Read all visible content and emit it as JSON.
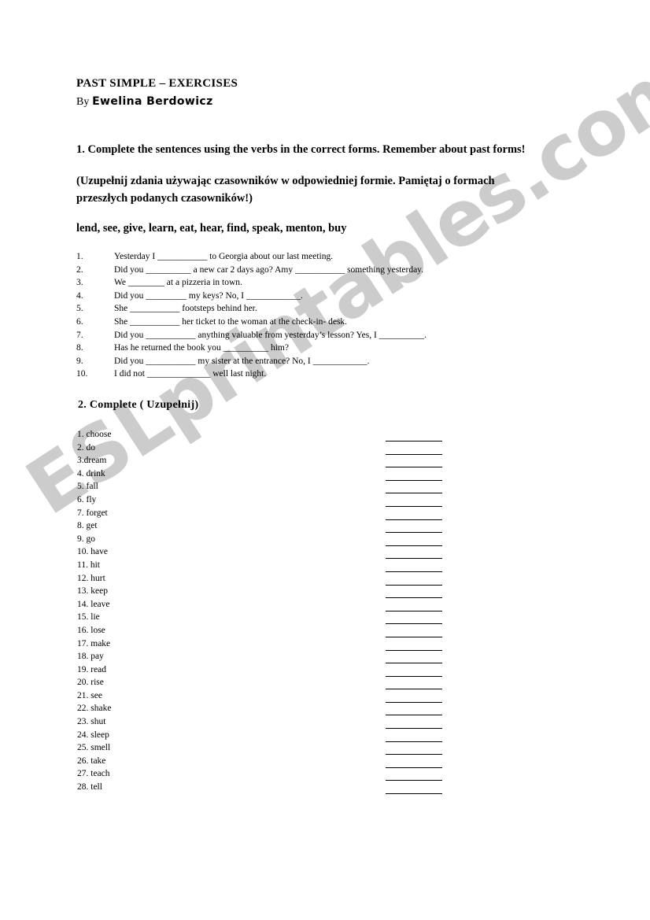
{
  "document": {
    "title": "PAST SIMPLE – EXERCISES",
    "byline_prefix": "By",
    "author": "Ewelina  Berdowicz",
    "watermark": "ESLprintables.com",
    "watermark_color": "#cccccc",
    "page_background": "#ffffff",
    "text_color": "#000000"
  },
  "exercise1": {
    "instruction_en": "1. Complete the sentences using the verbs in the correct forms. Remember about past forms!",
    "instruction_pl": "(Uzupełnij zdania używając czasowników w odpowiedniej formie. Pamiętaj o formach przeszłych podanych czasowników!)",
    "verb_bank": "lend, see, give, learn, eat, hear, find, speak, menton, buy",
    "sentences": [
      {
        "num": "1.",
        "text": "Yesterday I ___________ to Georgia about our last meeting."
      },
      {
        "num": "2.",
        "text": " Did you __________ a new car 2 days ago? Amy ___________ something yesterday."
      },
      {
        "num": "3.",
        "text": "We ________ at a pizzeria in town."
      },
      {
        "num": "4.",
        "text": "Did you _________ my keys? No, I ____________."
      },
      {
        "num": "5.",
        "text": "She ___________ footsteps behind her."
      },
      {
        "num": "6.",
        "text": "She ___________ her ticket to the woman at the check-in- desk."
      },
      {
        "num": "7.",
        "text": "Did you ___________ anything valuable from yesterday’s lesson? Yes, I __________."
      },
      {
        "num": "8.",
        "text": "Has he returned the book you __________ him?"
      },
      {
        "num": "9.",
        "text": "Did you ___________ my sister at the entrance? No, I ____________."
      },
      {
        "num": "10.",
        "text": "I did not ______________ well last night."
      }
    ]
  },
  "exercise2": {
    "heading": "2.  Complete ( Uzupełnij)",
    "verbs": [
      "1. choose",
      "2. do",
      "3.dream",
      "4. drink",
      "5. fall",
      "6. fly",
      "7. forget",
      "8. get",
      "9. go",
      "10. have",
      "11. hit",
      "12. hurt",
      "13. keep",
      "14. leave",
      "15. lie",
      "16. lose",
      "17. make",
      "18. pay",
      "19. read",
      "20. rise",
      "21. see",
      "22. shake",
      "23. shut",
      "24. sleep",
      "25. smell",
      "26. take",
      "27. teach",
      "28. tell"
    ],
    "answer_line_count": 28
  }
}
